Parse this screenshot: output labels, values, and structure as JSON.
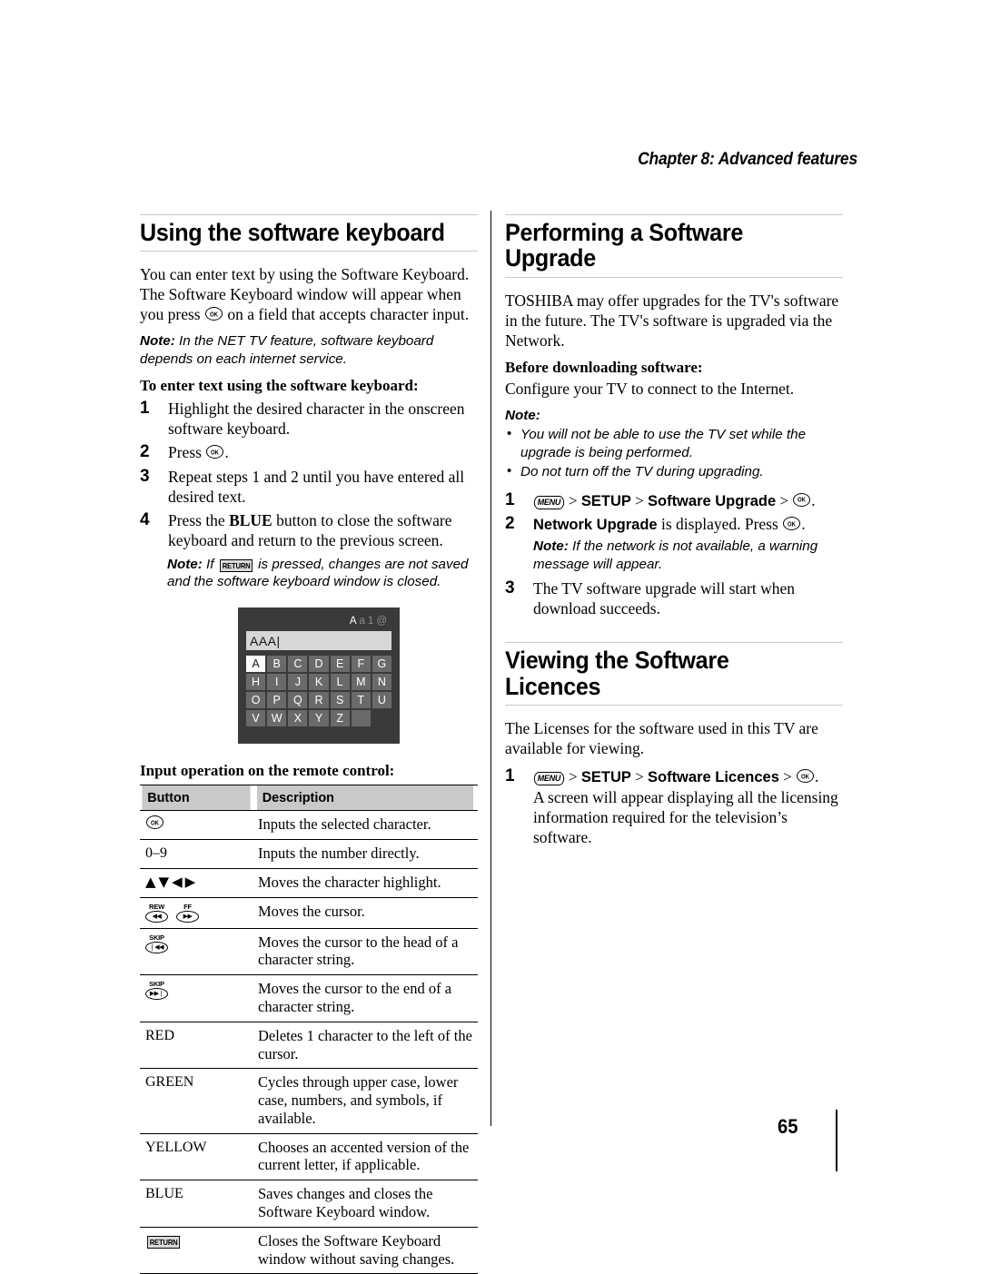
{
  "chapter": {
    "header": "Chapter 8: Advanced features"
  },
  "page_number": "65",
  "left_column": {
    "heading": "Using the software keyboard",
    "intro_part1": "You can enter text by using the Software Keyboard. The Software Keyboard window will appear when you press ",
    "intro_part2": " on a field that accepts character input.",
    "note_label": "Note:",
    "note_text": " In the NET TV feature, software keyboard depends on each internet service.",
    "steps_title": "To enter text using the software keyboard:",
    "steps": [
      {
        "num": "1",
        "text": "Highlight the desired character in the onscreen software keyboard."
      },
      {
        "num": "2",
        "text_before": "Press ",
        "text_after": "."
      },
      {
        "num": "3",
        "text": "Repeat steps 1 and 2 until you have entered all desired text."
      },
      {
        "num": "4",
        "text_before": "Press the ",
        "bold": "BLUE",
        "text_after": " button to close the software keyboard and return to the previous screen."
      }
    ],
    "step4_note_label": "Note:",
    "step4_note_before": " If ",
    "step4_note_glyph": "RETURN",
    "step4_note_after": " is pressed, changes are not saved and the software keyboard window is closed.",
    "keyboard": {
      "modes": [
        {
          "label": "A",
          "active": true
        },
        {
          "label": "a",
          "active": false
        },
        {
          "label": "1",
          "active": false
        },
        {
          "label": "@",
          "active": false
        }
      ],
      "field_value": "AAA|",
      "keys": [
        {
          "label": "A",
          "selected": true
        },
        {
          "label": "B",
          "selected": false
        },
        {
          "label": "C",
          "selected": false
        },
        {
          "label": "D",
          "selected": false
        },
        {
          "label": "E",
          "selected": false
        },
        {
          "label": "F",
          "selected": false
        },
        {
          "label": "G",
          "selected": false
        },
        {
          "label": "H",
          "selected": false
        },
        {
          "label": "I",
          "selected": false
        },
        {
          "label": "J",
          "selected": false
        },
        {
          "label": "K",
          "selected": false
        },
        {
          "label": "L",
          "selected": false
        },
        {
          "label": "M",
          "selected": false
        },
        {
          "label": "N",
          "selected": false
        },
        {
          "label": "O",
          "selected": false
        },
        {
          "label": "P",
          "selected": false
        },
        {
          "label": "Q",
          "selected": false
        },
        {
          "label": "R",
          "selected": false
        },
        {
          "label": "S",
          "selected": false
        },
        {
          "label": "T",
          "selected": false
        },
        {
          "label": "U",
          "selected": false
        },
        {
          "label": "V",
          "selected": false
        },
        {
          "label": "W",
          "selected": false
        },
        {
          "label": "X",
          "selected": false
        },
        {
          "label": "Y",
          "selected": false
        },
        {
          "label": "Z",
          "selected": false
        },
        {
          "label": " ",
          "selected": false,
          "blank": true
        },
        {
          "label": "",
          "selected": false,
          "empty": true
        }
      ]
    },
    "table": {
      "title": "Input operation on the remote control:",
      "columns": [
        "Button",
        "Description"
      ],
      "rows": [
        {
          "button_type": "ok-icon",
          "button_label": "OK",
          "description": "Inputs the selected character."
        },
        {
          "button_type": "text",
          "button_label": "0–9",
          "description": "Inputs the number directly."
        },
        {
          "button_type": "arrows",
          "button_label": "▲▼◀▶",
          "description": "Moves the character highlight."
        },
        {
          "button_type": "transport2",
          "button_label": "REW FF",
          "transport": [
            {
              "lbl": "REW",
              "glyph": "◀◀"
            },
            {
              "lbl": "FF",
              "glyph": "▶▶"
            }
          ],
          "description": "Moves the cursor."
        },
        {
          "button_type": "transport1",
          "button_label": "SKIP",
          "transport": [
            {
              "lbl": "SKIP",
              "glyph": "❘◀◀"
            }
          ],
          "description": "Moves the cursor to the head of a character string."
        },
        {
          "button_type": "transport1",
          "button_label": "SKIP",
          "transport": [
            {
              "lbl": "SKIP",
              "glyph": "▶▶❘"
            }
          ],
          "description": "Moves the cursor to the end of a character string."
        },
        {
          "button_type": "text",
          "button_label": "RED",
          "description": "Deletes 1 character to the left of the cursor."
        },
        {
          "button_type": "text",
          "button_label": "GREEN",
          "description": "Cycles through upper case, lower case, numbers, and symbols, if available."
        },
        {
          "button_type": "text",
          "button_label": "YELLOW",
          "description": "Chooses an accented version of the current letter, if applicable."
        },
        {
          "button_type": "text",
          "button_label": "BLUE",
          "description": "Saves changes and closes the Software Keyboard window."
        },
        {
          "button_type": "return-icon",
          "button_label": "RETURN",
          "description": "Closes the Software Keyboard window without saving changes."
        }
      ]
    }
  },
  "right_column": {
    "upgrade": {
      "heading": "Performing a Software Upgrade",
      "intro": "TOSHIBA may offer upgrades for the TV's software in the future. The TV's software is upgraded via the Network.",
      "before_heading": "Before downloading software:",
      "before_text": "Configure your TV to connect to the Internet.",
      "note_label": "Note:",
      "notes": [
        "You will not be able to use the TV set while the upgrade is being performed.",
        "Do not turn off the TV during upgrading."
      ],
      "steps": [
        {
          "num": "1",
          "menu_glyph": "MENU",
          "path": [
            "SETUP",
            "Software Upgrade"
          ],
          "end": "."
        },
        {
          "num": "2",
          "bold": "Network Upgrade",
          "text_mid": " is displayed. Press ",
          "text_end": ".",
          "note_label": "Note:",
          "note_text": " If the network is not available, a warning message will appear."
        },
        {
          "num": "3",
          "text": "The TV software upgrade will start when download succeeds."
        }
      ]
    },
    "licences": {
      "heading": "Viewing the Software Licences",
      "intro": "The Licenses for the software used in this TV are available for viewing.",
      "step": {
        "num": "1",
        "menu_glyph": "MENU",
        "path": [
          "SETUP",
          "Software Licences"
        ],
        "end": ".",
        "detail": "A screen will appear displaying all the licensing information required for the television’s software."
      }
    }
  }
}
